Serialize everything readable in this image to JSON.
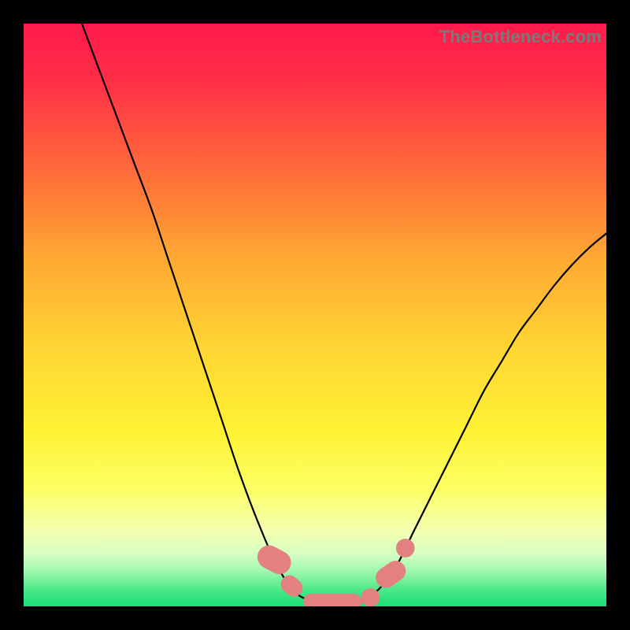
{
  "watermark": "TheBottleneck.com",
  "chart_data": {
    "type": "line",
    "title": "",
    "xlabel": "",
    "ylabel": "",
    "xlim": [
      0,
      100
    ],
    "ylim": [
      0,
      100
    ],
    "background_gradient": {
      "stops": [
        {
          "offset": 0.0,
          "color": "#ff1a4b"
        },
        {
          "offset": 0.1,
          "color": "#ff2f47"
        },
        {
          "offset": 0.25,
          "color": "#ff6a3a"
        },
        {
          "offset": 0.4,
          "color": "#ffa733"
        },
        {
          "offset": 0.55,
          "color": "#ffd433"
        },
        {
          "offset": 0.7,
          "color": "#fff233"
        },
        {
          "offset": 0.8,
          "color": "#fcff66"
        },
        {
          "offset": 0.87,
          "color": "#f3ffb0"
        },
        {
          "offset": 0.91,
          "color": "#d6ffc2"
        },
        {
          "offset": 0.94,
          "color": "#9ef7ae"
        },
        {
          "offset": 0.97,
          "color": "#4fe989"
        },
        {
          "offset": 1.0,
          "color": "#17df77"
        }
      ]
    },
    "series": [
      {
        "name": "bottleneck-curve",
        "stroke": "#000000",
        "stroke_width": 2.2,
        "points": [
          {
            "x": 10.0,
            "y": 100.0
          },
          {
            "x": 13.0,
            "y": 92.0
          },
          {
            "x": 16.0,
            "y": 84.0
          },
          {
            "x": 19.0,
            "y": 76.0
          },
          {
            "x": 22.0,
            "y": 68.0
          },
          {
            "x": 25.0,
            "y": 59.0
          },
          {
            "x": 28.0,
            "y": 50.0
          },
          {
            "x": 31.0,
            "y": 41.0
          },
          {
            "x": 34.0,
            "y": 32.0
          },
          {
            "x": 37.0,
            "y": 23.0
          },
          {
            "x": 40.0,
            "y": 15.0
          },
          {
            "x": 43.0,
            "y": 8.0
          },
          {
            "x": 46.0,
            "y": 3.0
          },
          {
            "x": 49.0,
            "y": 1.0
          },
          {
            "x": 52.0,
            "y": 0.5
          },
          {
            "x": 55.0,
            "y": 0.5
          },
          {
            "x": 58.0,
            "y": 1.0
          },
          {
            "x": 61.0,
            "y": 3.0
          },
          {
            "x": 64.0,
            "y": 7.0
          },
          {
            "x": 67.0,
            "y": 13.0
          },
          {
            "x": 70.0,
            "y": 19.0
          },
          {
            "x": 73.0,
            "y": 25.0
          },
          {
            "x": 76.0,
            "y": 31.0
          },
          {
            "x": 79.0,
            "y": 37.0
          },
          {
            "x": 82.0,
            "y": 42.0
          },
          {
            "x": 85.0,
            "y": 47.0
          },
          {
            "x": 88.0,
            "y": 51.0
          },
          {
            "x": 91.0,
            "y": 55.0
          },
          {
            "x": 94.0,
            "y": 58.5
          },
          {
            "x": 97.0,
            "y": 61.5
          },
          {
            "x": 100.0,
            "y": 64.0
          }
        ]
      }
    ],
    "markers": {
      "color": "#e38080",
      "items": [
        {
          "shape": "round-rect",
          "cx": 43.0,
          "cy": 8.0,
          "w": 4.0,
          "h": 6.0,
          "rot": -62
        },
        {
          "shape": "round-rect",
          "cx": 46.0,
          "cy": 3.5,
          "w": 3.0,
          "h": 4.0,
          "rot": -50
        },
        {
          "shape": "round-rect",
          "cx": 53.0,
          "cy": 0.8,
          "w": 10.0,
          "h": 2.8,
          "rot": 0
        },
        {
          "shape": "circle",
          "cx": 59.5,
          "cy": 1.5,
          "r": 1.6
        },
        {
          "shape": "round-rect",
          "cx": 63.0,
          "cy": 5.5,
          "w": 3.5,
          "h": 5.5,
          "rot": 55
        },
        {
          "shape": "circle",
          "cx": 65.5,
          "cy": 10.0,
          "r": 1.6
        }
      ]
    }
  }
}
